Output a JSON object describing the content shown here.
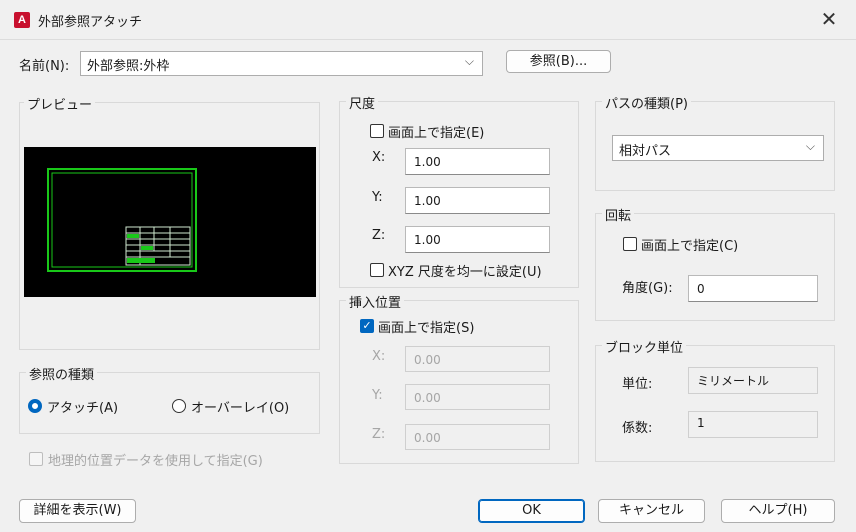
{
  "window": {
    "title": "外部参照アタッチ",
    "app_icon": "A",
    "close_glyph": "✕"
  },
  "name": {
    "label": "名前(N):",
    "value": "外部参照:外枠",
    "chevron": "⌵",
    "browse_label": "参照(B)..."
  },
  "preview": {
    "title": "プレビュー"
  },
  "reference_type": {
    "title": "参照の種類",
    "options": [
      {
        "label": "アタッチ(A)",
        "selected": true
      },
      {
        "label": "オーバーレイ(O)",
        "selected": false
      }
    ]
  },
  "geo_location": {
    "label": "地理的位置データを使用して指定(G)",
    "checked": false,
    "enabled": false
  },
  "scale": {
    "title": "尺度",
    "specify_on_screen": "画面上で指定(E)",
    "x_label": "X:",
    "x": "1.00",
    "y_label": "Y:",
    "y": "1.00",
    "z_label": "Z:",
    "z": "1.00",
    "uniform": "XYZ 尺度を均一に設定(U)"
  },
  "insertion": {
    "title": "挿入位置",
    "specify_on_screen": "画面上で指定(S)",
    "specify_checked": true,
    "x_label": "X:",
    "x": "0.00",
    "y_label": "Y:",
    "y": "0.00",
    "z_label": "Z:",
    "z": "0.00"
  },
  "path_type": {
    "title": "パスの種類(P)",
    "value": "相対パス",
    "chevron": "⌵"
  },
  "rotation": {
    "title": "回転",
    "specify_on_screen": "画面上で指定(C)",
    "angle_label": "角度(G):",
    "angle": "0"
  },
  "block_unit": {
    "title": "ブロック単位",
    "unit_label": "単位:",
    "unit": "ミリメートル",
    "factor_label": "係数:",
    "factor": "1"
  },
  "footer": {
    "details": "詳細を表示(W)",
    "ok": "OK",
    "cancel": "キャンセル",
    "help": "ヘルプ(H)"
  },
  "colors": {
    "accent": "#0067c0",
    "brand": "#c8102e",
    "preview_bg": "#000000",
    "preview_frame": "#19c819"
  }
}
